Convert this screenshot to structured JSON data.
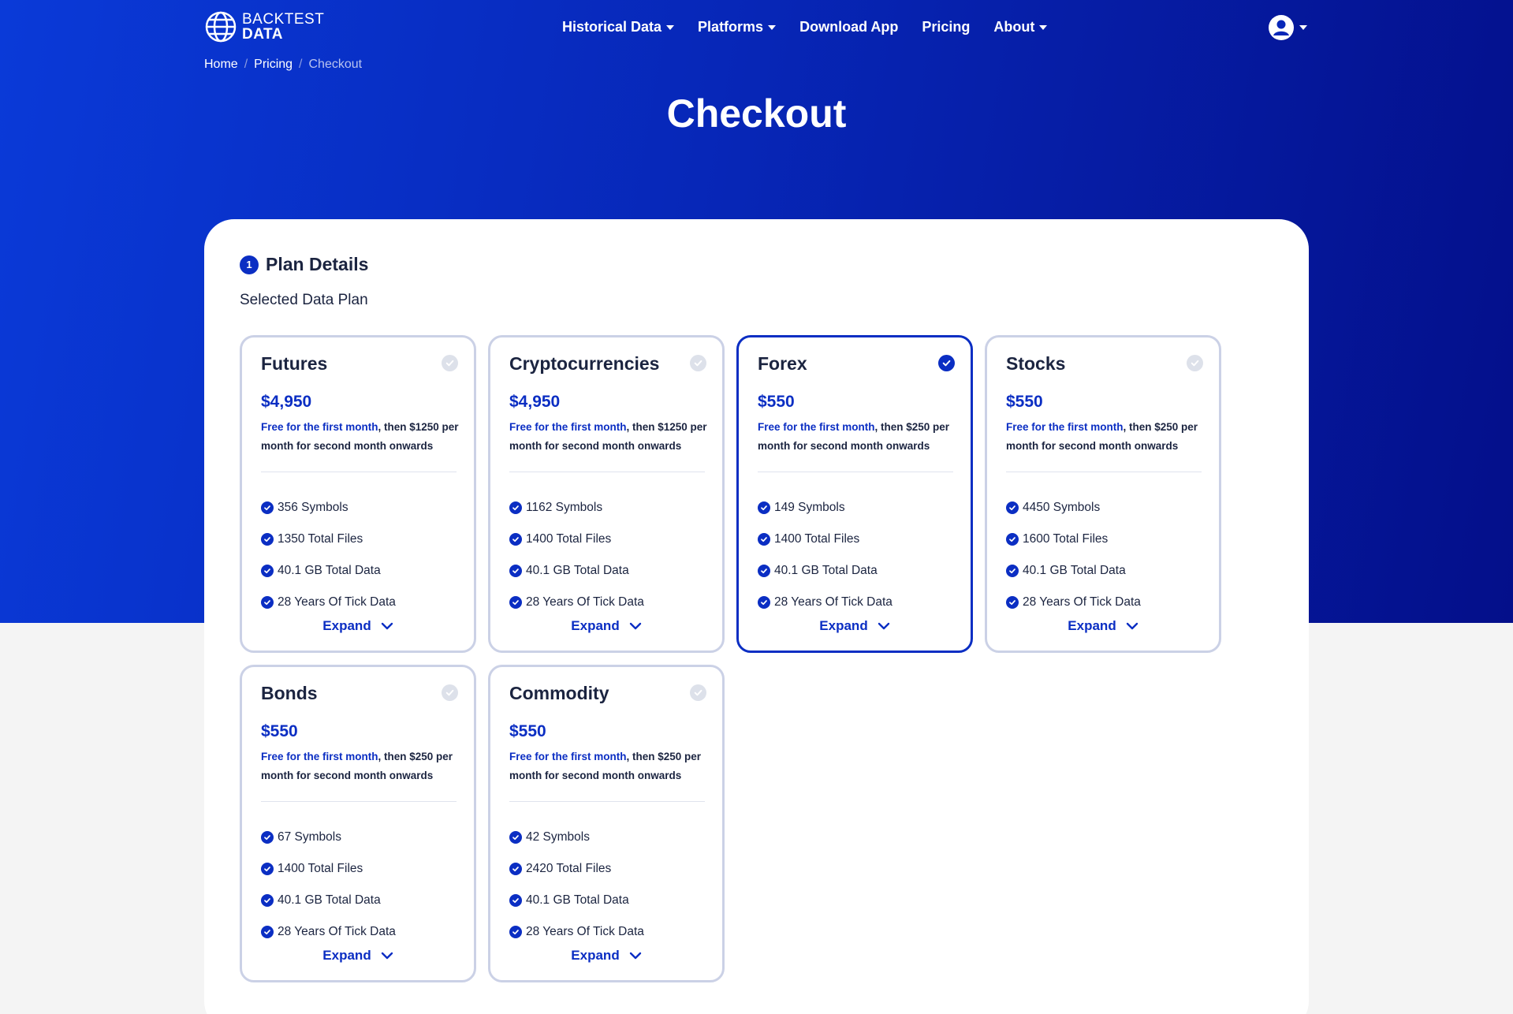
{
  "header": {
    "logo_line1": "BACKTEST",
    "logo_line2": "DATA",
    "nav": [
      {
        "label": "Historical Data",
        "dropdown": true
      },
      {
        "label": "Platforms",
        "dropdown": true
      },
      {
        "label": "Download App",
        "dropdown": false
      },
      {
        "label": "Pricing",
        "dropdown": false
      },
      {
        "label": "About",
        "dropdown": true
      }
    ]
  },
  "breadcrumb": {
    "home": "Home",
    "pricing": "Pricing",
    "current": "Checkout",
    "separator": "/"
  },
  "page_title": "Checkout",
  "step": {
    "number": "1",
    "title": "Plan Details",
    "subtitle": "Selected Data Plan"
  },
  "colors": {
    "accent": "#0b2ec3",
    "hero_start": "#0a3ad8",
    "hero_end": "#040f8a"
  },
  "plans": [
    {
      "name": "Futures",
      "price": "$4,950",
      "free_text": "Free for the first month",
      "then_text": ", then $1250 per month for second month onwards",
      "features": [
        "356 Symbols",
        "1350 Total Files",
        "40.1 GB Total Data",
        "28 Years Of Tick Data"
      ],
      "expand": "Expand",
      "selected": false
    },
    {
      "name": "Cryptocurrencies",
      "price": "$4,950",
      "free_text": "Free for the first month",
      "then_text": ", then $1250 per month for second month onwards",
      "features": [
        "1162 Symbols",
        "1400 Total Files",
        "40.1 GB Total Data",
        "28 Years Of Tick Data"
      ],
      "expand": "Expand",
      "selected": false
    },
    {
      "name": "Forex",
      "price": "$550",
      "free_text": "Free for the first month",
      "then_text": ", then $250 per month for second month onwards",
      "features": [
        "149 Symbols",
        "1400 Total Files",
        "40.1 GB Total Data",
        "28 Years Of Tick Data"
      ],
      "expand": "Expand",
      "selected": true
    },
    {
      "name": "Stocks",
      "price": "$550",
      "free_text": "Free for the first month",
      "then_text": ", then $250 per month for second month onwards",
      "features": [
        "4450 Symbols",
        "1600 Total Files",
        "40.1 GB Total Data",
        "28 Years Of Tick Data"
      ],
      "expand": "Expand",
      "selected": false
    },
    {
      "name": "Bonds",
      "price": "$550",
      "free_text": "Free for the first month",
      "then_text": ", then $250 per month for second month onwards",
      "features": [
        "67 Symbols",
        "1400 Total Files",
        "40.1 GB Total Data",
        "28 Years Of Tick Data"
      ],
      "expand": "Expand",
      "selected": false
    },
    {
      "name": "Commodity",
      "price": "$550",
      "free_text": "Free for the first month",
      "then_text": ", then $250 per month for second month onwards",
      "features": [
        "42 Symbols",
        "2420 Total Files",
        "40.1 GB Total Data",
        "28 Years Of Tick Data"
      ],
      "expand": "Expand",
      "selected": false
    }
  ]
}
